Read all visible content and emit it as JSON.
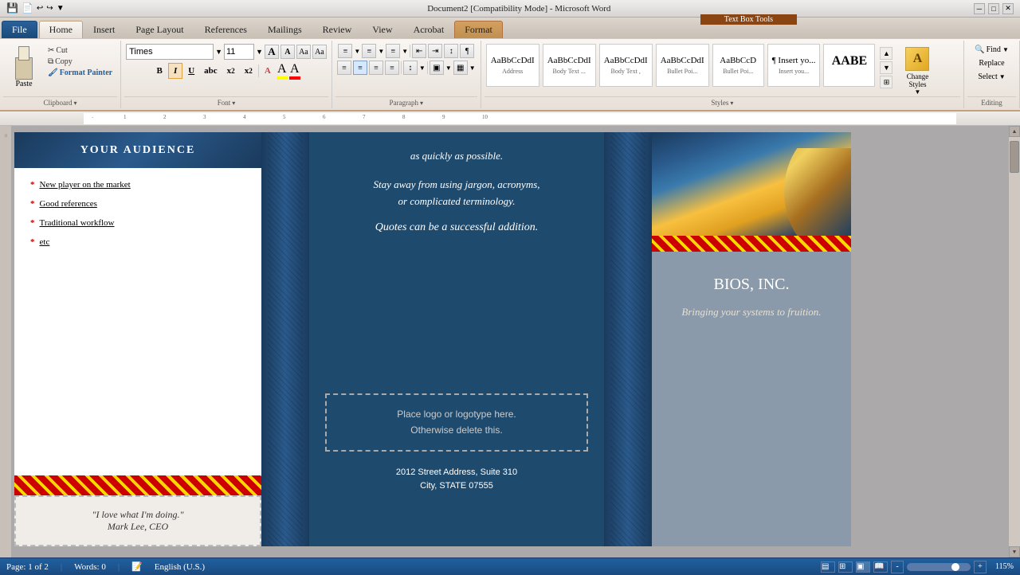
{
  "titlebar": {
    "title": "Document2 [Compatibility Mode] - Microsoft Word",
    "min": "─",
    "max": "□",
    "close": "✕"
  },
  "contextual_tab": {
    "label": "Text Box Tools"
  },
  "tabs": {
    "file": "File",
    "home": "Home",
    "insert": "Insert",
    "page_layout": "Page Layout",
    "references": "References",
    "mailings": "Mailings",
    "review": "Review",
    "view": "View",
    "acrobat": "Acrobat",
    "format": "Format"
  },
  "clipboard": {
    "paste_label": "Paste",
    "cut_label": "Cut",
    "copy_label": "Copy",
    "format_painter_label": "Format Painter",
    "group_label": "Clipboard"
  },
  "font": {
    "family": "Times",
    "size": "11",
    "bold": "B",
    "italic": "I",
    "underline": "U",
    "strikethrough": "abc",
    "subscript": "x₂",
    "superscript": "x²",
    "change_case": "Aa",
    "text_highlight": "A",
    "font_color": "A",
    "grow": "A",
    "shrink": "A",
    "clear": "Aa",
    "group_label": "Font"
  },
  "paragraph": {
    "bullets": "≡",
    "numbering": "≡",
    "multilevel": "≡",
    "decrease_indent": "≡",
    "increase_indent": "≡",
    "sort": "↓",
    "show_para": "¶",
    "align_left": "≡",
    "align_center": "≡",
    "align_right": "≡",
    "justify": "≡",
    "line_spacing": "≡",
    "shading": "□",
    "borders": "□",
    "group_label": "Paragraph"
  },
  "styles": {
    "items": [
      {
        "label": "Address",
        "text": "AaBbCcDdI",
        "class": "address"
      },
      {
        "label": "Body Text ...",
        "text": "AaBbCcDdI",
        "class": "body-text-1"
      },
      {
        "label": "Body Text ...",
        "text": "AaBbCcDdI",
        "class": "body-text-2"
      },
      {
        "label": "Bullet Poi...",
        "text": "AaBbCcDdI",
        "class": "bullet-poi-1"
      },
      {
        "label": "Bullet Poi...",
        "text": "AaBbCcD",
        "class": "bullet-poi-2"
      },
      {
        "label": "Insert you...",
        "text": "1 Insert you...",
        "class": "insert-you"
      },
      {
        "label": "Change Styles",
        "text": "AABE",
        "class": "change-styles"
      }
    ],
    "group_label": "Styles",
    "change_styles_label": "Change\nStyles"
  },
  "editing": {
    "find_label": "Find",
    "replace_label": "Replace",
    "select_label": "Select",
    "group_label": "Editing"
  },
  "document": {
    "panel_left": {
      "header": "YOUR AUDIENCE",
      "bullets": [
        "New player on the market",
        "Good references",
        "Traditional workflow",
        "etc"
      ],
      "quote": "\"I love what I'm doing.\"\nMark Lee, CEO"
    },
    "panel_middle": {
      "text1": "as quickly as possible.",
      "text2": "Stay away from using jargon, acronyms,\nor complicated terminology.",
      "text3": "Quotes can be a successful addition.",
      "logo_text": "Place logo  or logotype here.\nOtherwise delete this.",
      "address1": "2012 Street Address,  Suite 310",
      "address2": "City, STATE 07555"
    },
    "panel_right": {
      "company_name": "BIOS, INC.",
      "tagline": "Bringing your systems to fruition."
    }
  },
  "statusbar": {
    "page_label": "Page: 1 of 2",
    "words_label": "Words: 0",
    "language": "English (U.S.)",
    "zoom": "115%"
  }
}
